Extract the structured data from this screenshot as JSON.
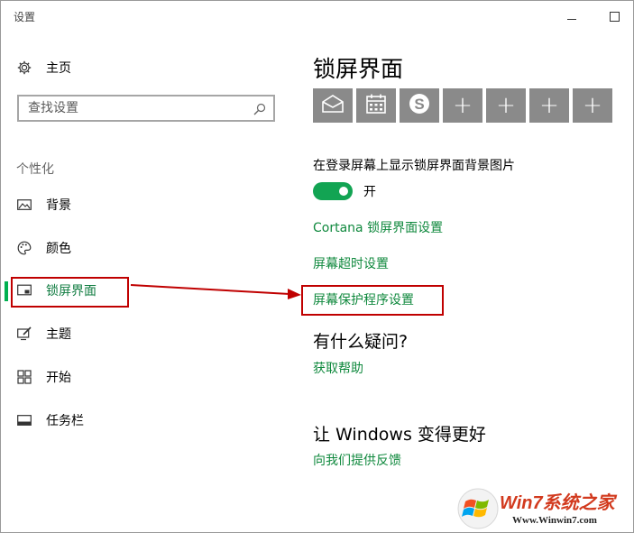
{
  "window": {
    "title": "设置"
  },
  "sidebar": {
    "home_label": "主页",
    "search": {
      "placeholder": "查找设置"
    },
    "section_header": "个性化",
    "items": [
      {
        "label": "背景",
        "icon": "image-icon"
      },
      {
        "label": "颜色",
        "icon": "palette-icon"
      },
      {
        "label": "锁屏界面",
        "icon": "lock-screen-icon",
        "active": true
      },
      {
        "label": "主题",
        "icon": "theme-icon"
      },
      {
        "label": "开始",
        "icon": "start-icon"
      },
      {
        "label": "任务栏",
        "icon": "taskbar-icon"
      }
    ]
  },
  "main": {
    "title": "锁屏界面",
    "app_tiles": [
      "mail-icon",
      "calendar-icon",
      "skype-icon",
      "plus-icon",
      "plus-icon",
      "plus-icon",
      "plus-icon"
    ],
    "show_bg_label": "在登录屏幕上显示锁屏界面背景图片",
    "toggle_state": "开",
    "links": {
      "cortana": "Cortana 锁屏界面设置",
      "screen_timeout": "屏幕超时设置",
      "screensaver": "屏幕保护程序设置"
    },
    "question_header": "有什么疑问?",
    "get_help": "获取帮助",
    "improve_header": "让 Windows 变得更好",
    "feedback": "向我们提供反馈"
  },
  "watermark": {
    "brand": "Win7系统之家",
    "url": "Www.Winwin7.com"
  },
  "colors": {
    "accent": "#10893e",
    "toggle_on": "#12a453",
    "tile": "#8a8a8a",
    "annotation": "#c00000"
  }
}
